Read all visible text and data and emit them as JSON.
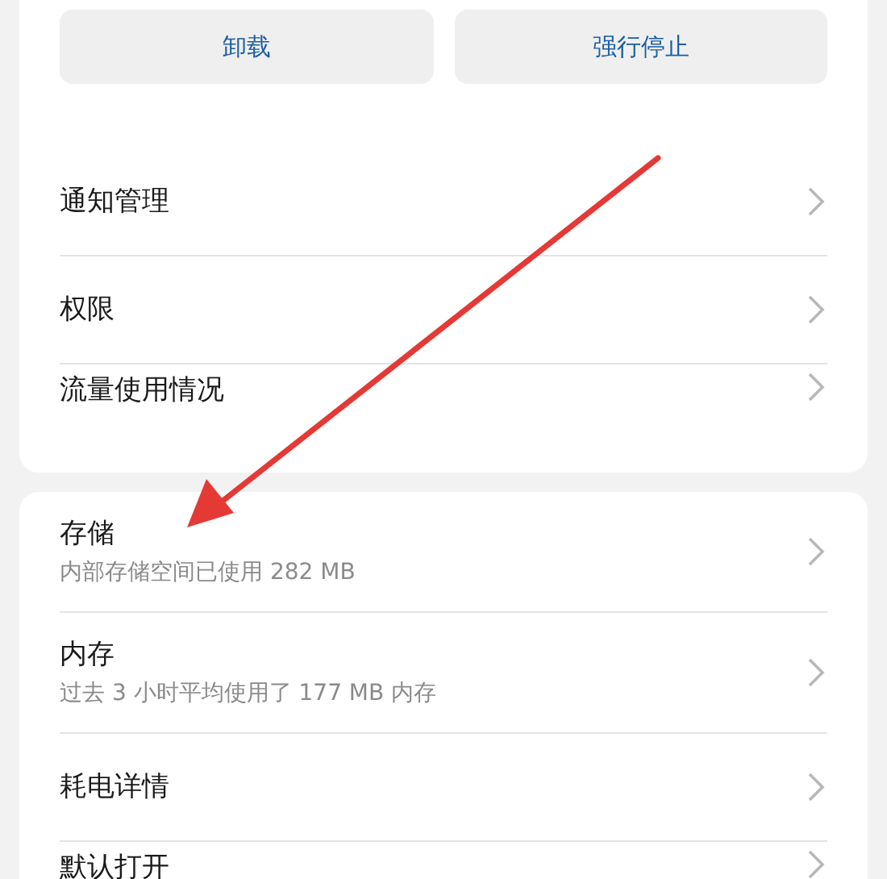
{
  "buttons": [
    {
      "label": "卸载"
    },
    {
      "label": "强行停止"
    }
  ],
  "sections": [
    {
      "items": [
        {
          "title": "通知管理"
        },
        {
          "title": "权限"
        },
        {
          "title": "流量使用情况"
        }
      ]
    },
    {
      "items": [
        {
          "title": "存储",
          "subtitle": "内部存储空间已使用 282 MB"
        },
        {
          "title": "内存",
          "subtitle": "过去 3 小时平均使用了 177 MB 内存"
        },
        {
          "title": "耗电详情"
        },
        {
          "title": "默认打开"
        }
      ]
    }
  ]
}
